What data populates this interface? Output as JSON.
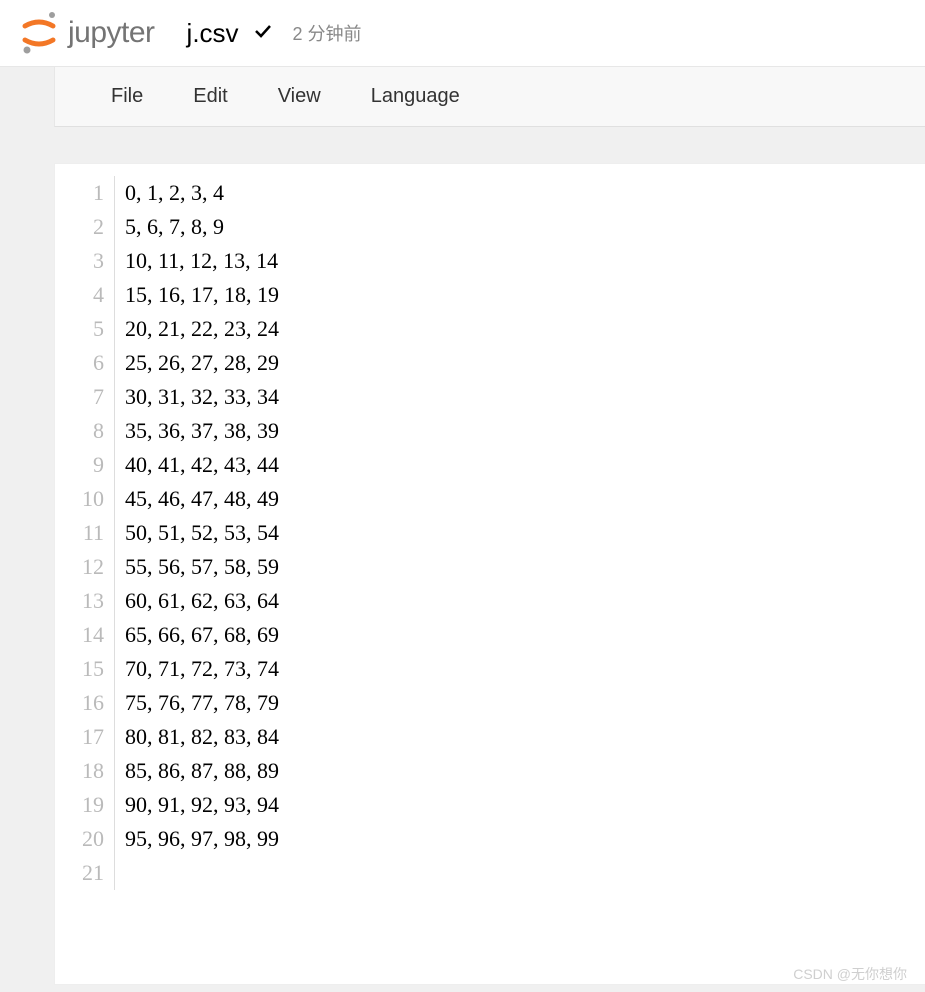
{
  "header": {
    "logo_text": "jupyter",
    "filename": "j.csv",
    "timestamp": "2 分钟前"
  },
  "menu": {
    "items": [
      "File",
      "Edit",
      "View",
      "Language"
    ]
  },
  "editor": {
    "lines": [
      "0, 1, 2, 3, 4",
      "5, 6, 7, 8, 9",
      "10, 11, 12, 13, 14",
      "15, 16, 17, 18, 19",
      "20, 21, 22, 23, 24",
      "25, 26, 27, 28, 29",
      "30, 31, 32, 33, 34",
      "35, 36, 37, 38, 39",
      "40, 41, 42, 43, 44",
      "45, 46, 47, 48, 49",
      "50, 51, 52, 53, 54",
      "55, 56, 57, 58, 59",
      "60, 61, 62, 63, 64",
      "65, 66, 67, 68, 69",
      "70, 71, 72, 73, 74",
      "75, 76, 77, 78, 79",
      "80, 81, 82, 83, 84",
      "85, 86, 87, 88, 89",
      "90, 91, 92, 93, 94",
      "95, 96, 97, 98, 99",
      ""
    ]
  },
  "watermark": "CSDN @无你想你"
}
